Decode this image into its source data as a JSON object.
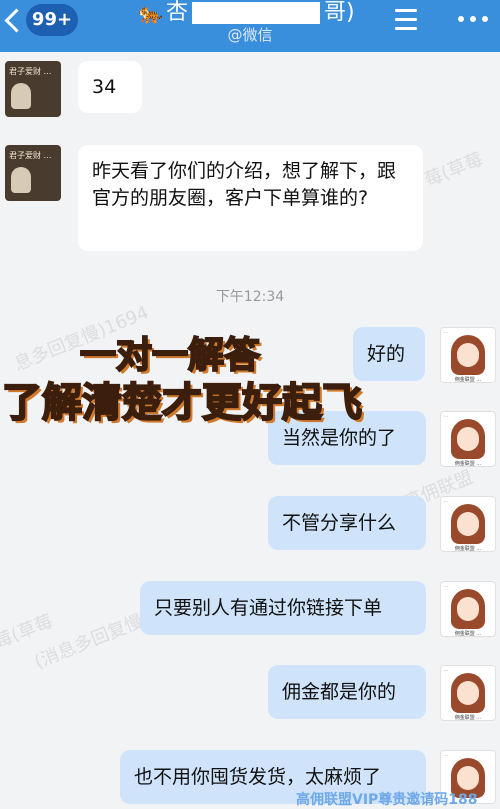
{
  "header": {
    "back_count": "99+",
    "title_prefix": "杏",
    "title_suffix": "哥)",
    "subtitle": "@微信",
    "colors": {
      "bar": "#3a8fdc",
      "badge": "#1d5fb0"
    }
  },
  "contact_avatar": {
    "text": "君子爱财 …"
  },
  "self_avatar": {
    "caption": "佣金联盟 …",
    "tag": "…"
  },
  "messages": {
    "m1": "34",
    "m2": "昨天看了你们的介绍，想了解下，跟官方的朋友圈，客户下单算谁的?",
    "timestamp": "下午12:34",
    "r1": "好的",
    "r2": "当然是你的了",
    "r3": "不管分享什么",
    "r4": "只要别人有通过你链接下单",
    "r5": "佣金都是你的",
    "r6": "也不用你囤货发货，太麻烦了"
  },
  "overlay": {
    "line1": "一对一解答",
    "line2": "了解清楚才更好起飞"
  },
  "watermarks": {
    "w1": "莓(草莓",
    "w2": "息多回复慢)1694",
    "w3": "高佣联盟",
    "w4": "(消息多回复慢)1694",
    "w5": "莓(草莓"
  },
  "footer_watermark": "高佣联盟VIP尊贵邀请码188"
}
